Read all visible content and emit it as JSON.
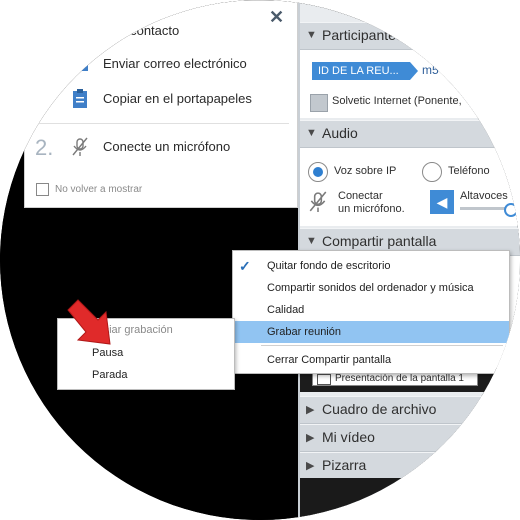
{
  "invite_popup": {
    "row_contact": "Invitar un contacto",
    "row_email": "Enviar correo electrónico",
    "row_copy": "Copiar en el portapapeles",
    "step_number": "2.",
    "row_mic": "Conecte un micrófono",
    "dont_show": "No volver a mostrar",
    "close_glyph": "✕"
  },
  "panel": {
    "participants_label": "Participantes",
    "meeting_id_label": "ID DE LA REU...",
    "meeting_id_suffix": "m5",
    "user_name": "Solvetic Internet (Ponente,",
    "audio_label": "Audio",
    "voip_label": "Voz sobre IP",
    "phone_label": "Teléfono",
    "connect_mic_line1": "Conectar",
    "connect_mic_line2": "un micrófono.",
    "speakers_label": "Altavoces",
    "share_label": "Compartir pantalla",
    "share_select": "Presentación de la pantalla 1",
    "file_box_label": "Cuadro de archivo",
    "my_video_label": "Mi vídeo",
    "whiteboard_label": "Pizarra"
  },
  "context_menu": {
    "items": [
      {
        "label": "Quitar fondo de escritorio",
        "checked": true
      },
      {
        "label": "Compartir sonidos del ordenador y música",
        "checked": false
      },
      {
        "label": "Calidad",
        "checked": false
      },
      {
        "label": "Grabar reunión",
        "checked": false,
        "highlighted": true
      },
      {
        "label": "Cerrar Compartir pantalla",
        "checked": false
      }
    ]
  },
  "record_menu": {
    "start": "Iniciar grabación",
    "pause": "Pausa",
    "stop": "Parada"
  },
  "colors": {
    "accent": "#3f8bd6",
    "highlight": "#91c4f2",
    "arrow": "#e02a2a"
  }
}
